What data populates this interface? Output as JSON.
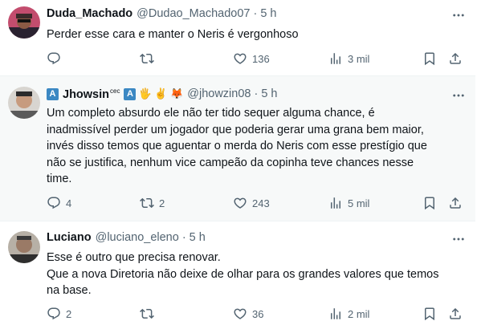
{
  "tweets": [
    {
      "name": "Duda_Machado",
      "handle": "@Dudao_Machado07",
      "sep": "·",
      "time": "5 h",
      "lines": [
        "Perder esse cara e manter o Neris é vergonhoso"
      ],
      "replies": "",
      "retweets": "",
      "likes": "136",
      "views": "3 mil"
    },
    {
      "name_badge": "A",
      "name": "Jhowsin",
      "name_sup": "cec",
      "badge2": "A",
      "emojis": "🖐 ✌ 🦊",
      "handle": "@jhowzin08",
      "sep": "·",
      "time": "5 h",
      "lines": [
        "Um completo absurdo ele não ter tido sequer alguma chance, é",
        "inadmissível perder um jogador que poderia gerar uma grana bem maior,",
        "invés disso temos que aguentar o merda do Neris com esse prestígio que",
        "não se justifica, nenhum vice campeão da copinha teve chances nesse",
        "time."
      ],
      "replies": "4",
      "retweets": "2",
      "likes": "243",
      "views": "5 mil"
    },
    {
      "name": "Luciano",
      "handle": "@luciano_eleno",
      "sep": "·",
      "time": "5 h",
      "lines": [
        "Esse é outro que precisa renovar.",
        "Que a nova Diretoria não deixe de olhar para os grandes valores que temos",
        "na base."
      ],
      "replies": "2",
      "retweets": "",
      "likes": "36",
      "views": "2 mil"
    }
  ],
  "colors": {
    "text": "#0f1419",
    "secondary": "#536471",
    "divider": "#eff3f4"
  },
  "icons": [
    "reply-icon",
    "retweet-icon",
    "like-icon",
    "views-icon",
    "bookmark-icon",
    "share-icon",
    "more-icon"
  ]
}
